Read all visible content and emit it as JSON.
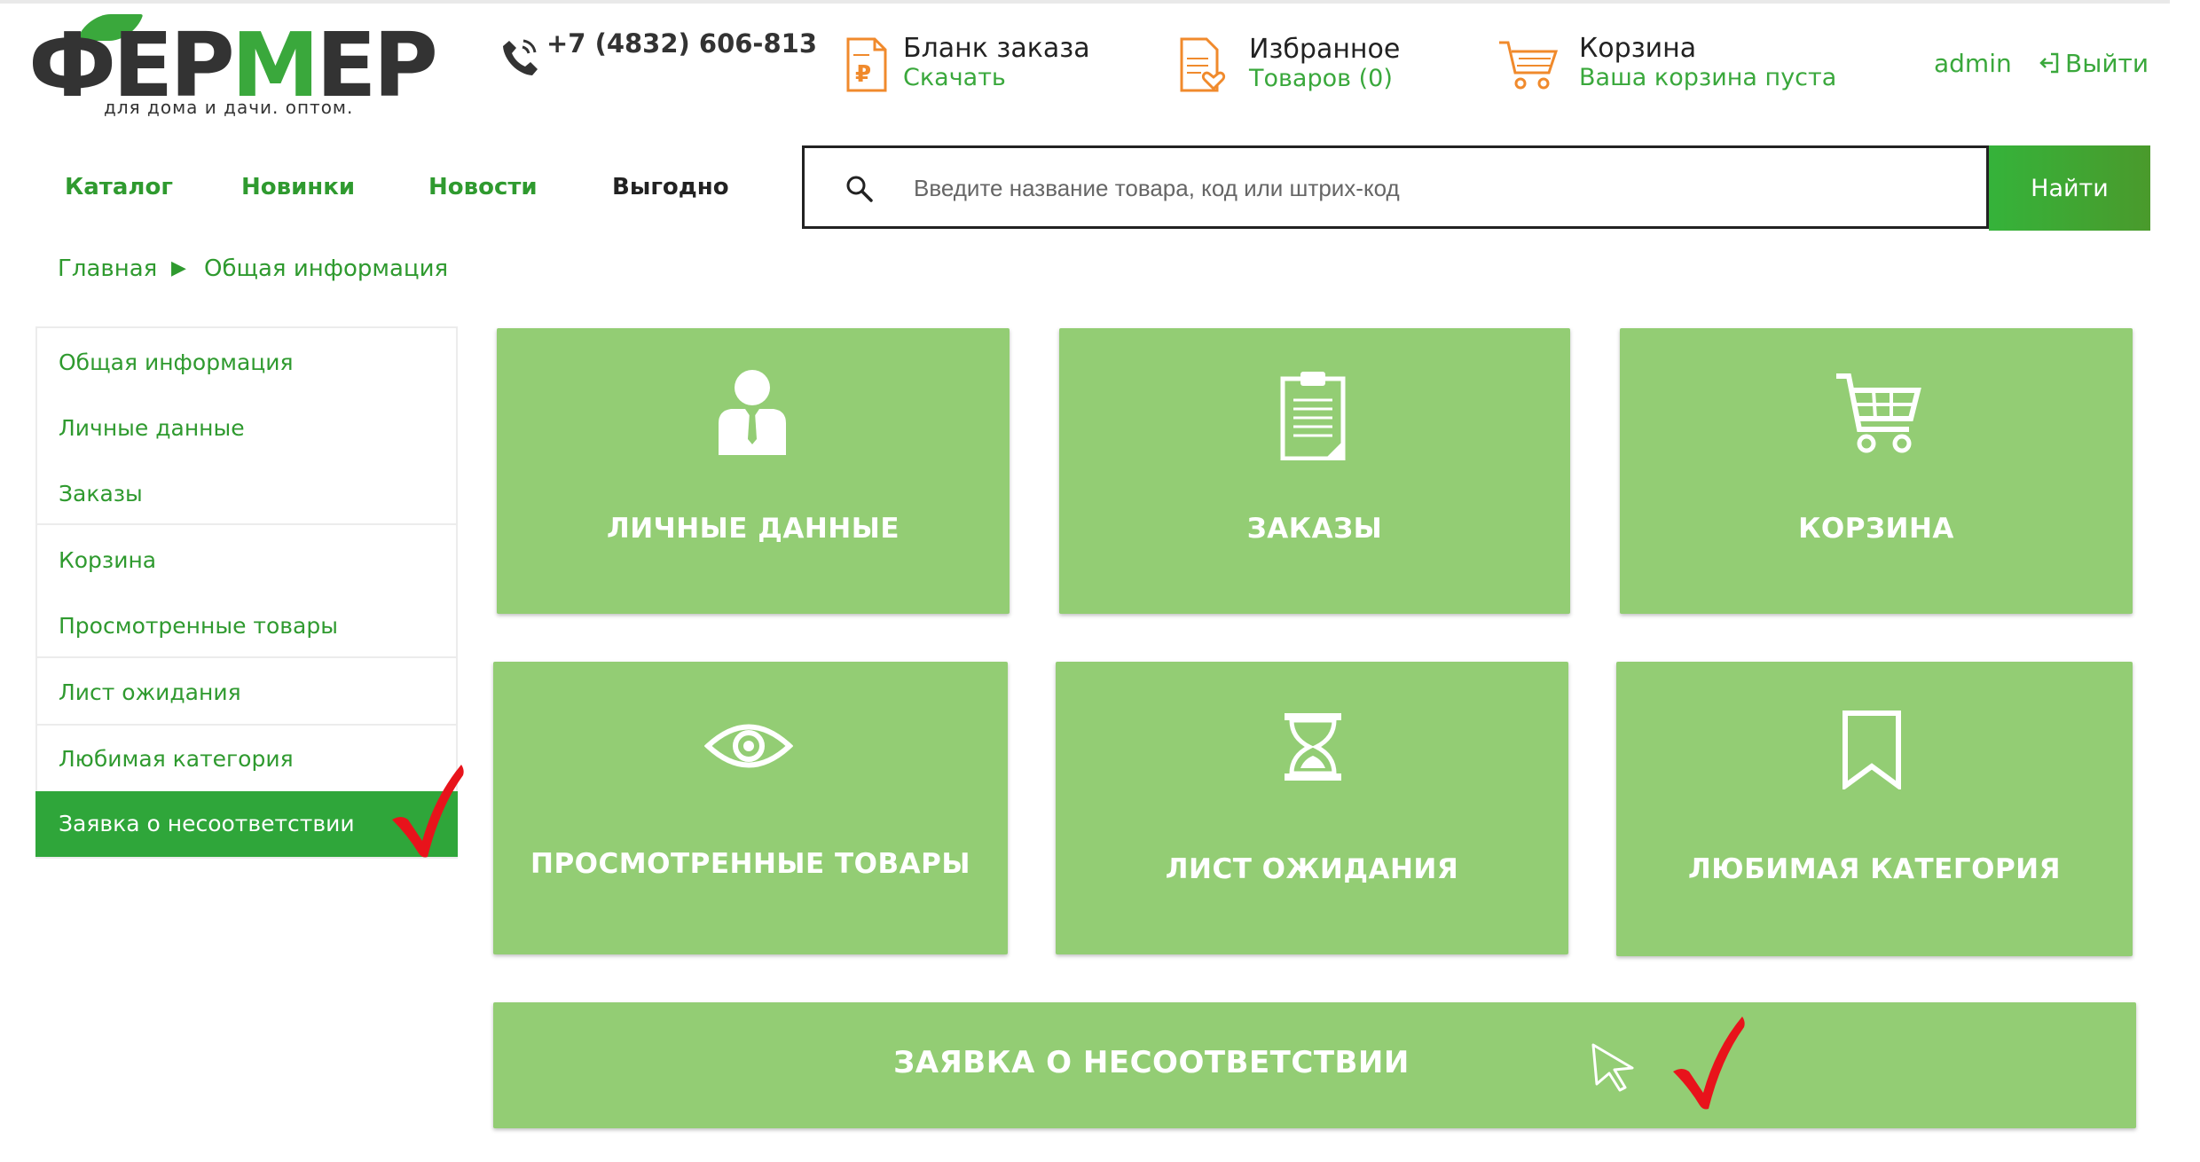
{
  "logo": {
    "word_left": "Ф",
    "word_mid": "ЕР",
    "word_green": "М",
    "word_right": "ЕР",
    "tagline": "для дома и дачи. оптом."
  },
  "header": {
    "phone": "+7 (4832) 606-813",
    "order_form": {
      "title": "Бланк заказа",
      "sub": "Скачать"
    },
    "favorites": {
      "title": "Избранное",
      "sub": "Товаров (0)"
    },
    "cart": {
      "title": "Корзина",
      "sub": "Ваша корзина пуста"
    },
    "user": "admin",
    "logout": "Выйти"
  },
  "nav": [
    "Каталог",
    "Новинки",
    "Новости",
    "Выгодно"
  ],
  "search": {
    "placeholder": "Введите название товара, код или штрих-код",
    "button": "Найти"
  },
  "breadcrumb": [
    "Главная",
    "Общая информация"
  ],
  "sidebar": {
    "items": [
      "Общая информация",
      "Личные данные",
      "Заказы",
      "Корзина",
      "Просмотренные товары",
      "Лист ожидания",
      "Любимая категория",
      "Заявка о несоответствии"
    ]
  },
  "tiles": [
    {
      "label": "ЛИЧНЫЕ ДАННЫЕ",
      "icon": "person-icon"
    },
    {
      "label": "ЗАКАЗЫ",
      "icon": "clipboard-icon"
    },
    {
      "label": "КОРЗИНА",
      "icon": "cart-icon"
    },
    {
      "label": "ПРОСМОТРЕННЫЕ ТОВАРЫ",
      "icon": "eye-icon"
    },
    {
      "label": "ЛИСТ ОЖИДАНИЯ",
      "icon": "hourglass-icon"
    },
    {
      "label": "ЛЮБИМАЯ КАТЕГОРИЯ",
      "icon": "bookmark-icon"
    }
  ],
  "wide_tile": {
    "label": "ЗАЯВКА О НЕСООТВЕТСТВИИ"
  },
  "colors": {
    "brand_green": "#3aa83c",
    "tile_green": "#93cd74",
    "active_green": "#2fa63a",
    "check_red": "#e8131b"
  }
}
